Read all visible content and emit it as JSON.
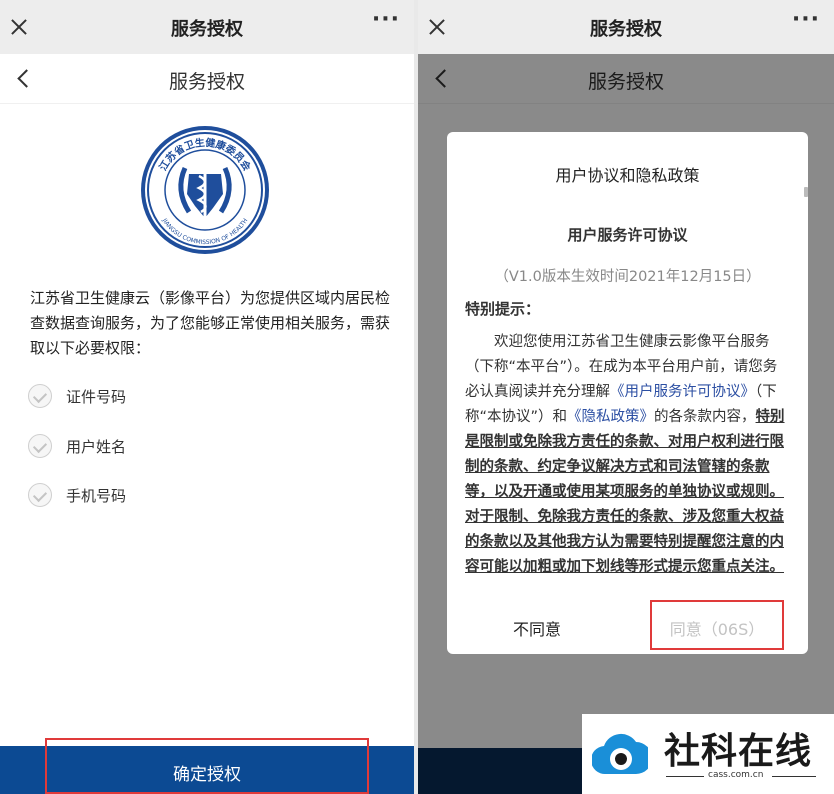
{
  "left": {
    "window_title": "服务授权",
    "more": "···",
    "nav_title": "服务授权",
    "description": "江苏省卫生健康云（影像平台）为您提供区域内居民检查数据查询服务，为了您能够正常使用相关服务，需获取以下必要权限：",
    "permissions": [
      "证件号码",
      "用户姓名",
      "手机号码"
    ],
    "confirm_label": "确定授权"
  },
  "right": {
    "window_title": "服务授权",
    "more": "···",
    "nav_title": "服务授权",
    "modal": {
      "title": "用户协议和隐私政策",
      "doc_title": "用户服务许可协议",
      "version": "（V1.0版本生效时间2021年12月15日）",
      "hint": "特别提示：",
      "p1": "欢迎您使用江苏省卫生健康云影像平台服务（下称“本平台”）。在成为本平台用户前，请您务必认真阅读并充分理解",
      "link1": "《用户服务许可协议》",
      "p2": "（下称“本协议”）和",
      "link2": "《隐私政策》",
      "p3": "的各条款内容，",
      "bold": "特别是限制或免除我方责任的条款、对用户权利进行限制的条款、约定争议解决方式和司法管辖的条款等，以及开通或使用某项服务的单独协议或规则。对于限制、免除我方责任的条款、涉及您重大权益的条款以及其他我方认为需要特别提醒您注意的内容可能以加粗或加下划线等形式提示您重点关注。",
      "disagree_label": "不同意",
      "agree_label": "同意（06S）"
    }
  },
  "logo": {
    "text_top": "江苏省卫生健康委员会",
    "text_bottom": "JIANGSU COMMISSION OF HEALTH",
    "color": "#1f4e9c"
  },
  "watermark": {
    "text": "社科在线",
    "url": "cass.com.cn",
    "color": "#1a8fd8"
  },
  "colors": {
    "primary": "#0c4a93",
    "highlight": "#e03a3a",
    "link": "#2c4fa3"
  }
}
